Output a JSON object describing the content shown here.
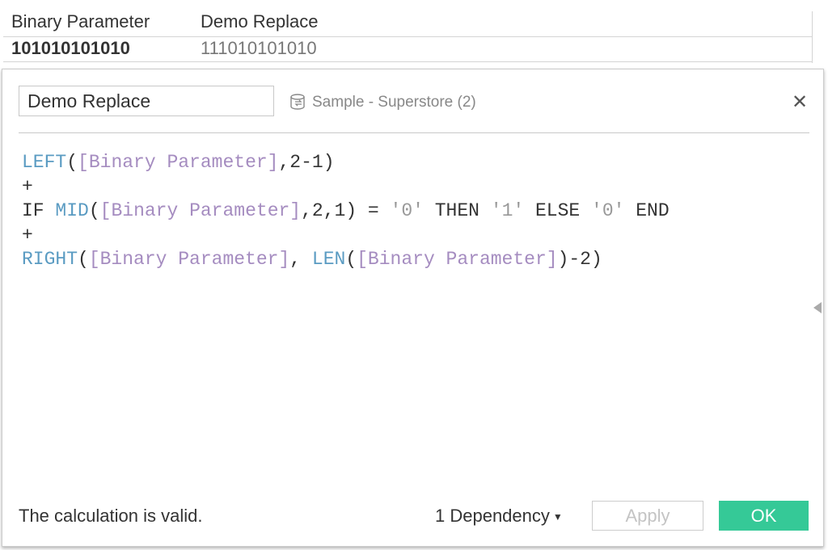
{
  "table": {
    "headers": [
      "Binary Parameter",
      "Demo Replace"
    ],
    "row": [
      "101010101010",
      "111010101010"
    ]
  },
  "dialog": {
    "calc_name": "Demo Replace",
    "datasource": "Sample - Superstore (2)",
    "datasource_icon": "database-icon",
    "close_icon": "close-icon",
    "code": {
      "l1": [
        "LEFT",
        "(",
        "[Binary Parameter]",
        ",2-1)"
      ],
      "l2": "+",
      "l3": [
        "IF ",
        "MID",
        "(",
        "[Binary Parameter]",
        ",2,1) = ",
        "'0'",
        " THEN ",
        "'1'",
        " ELSE ",
        "'0'",
        " END"
      ],
      "l4": "+",
      "l5": [
        "RIGHT",
        "(",
        "[Binary Parameter]",
        ", ",
        "LEN",
        "(",
        "[Binary Parameter]",
        ")-2)"
      ]
    },
    "status": "The calculation is valid.",
    "dependency": "1 Dependency",
    "apply": "Apply",
    "ok": "OK"
  },
  "colors": {
    "function": "#5a9bc2",
    "field": "#a58cc0",
    "ok_button": "#35c997"
  }
}
